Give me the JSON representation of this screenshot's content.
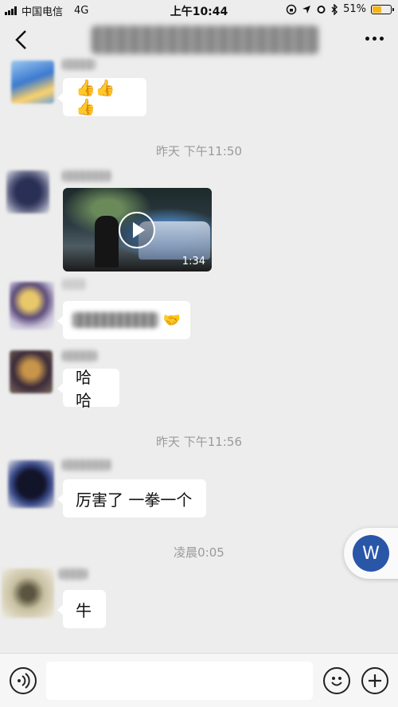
{
  "status_bar": {
    "carrier": "中国电信",
    "network": "4G",
    "time": "上午10:44",
    "battery_percent": "51%",
    "battery_level": 0.51
  },
  "messages": [
    {
      "type": "emoji",
      "content": "👍👍👍"
    },
    {
      "type": "timestamp",
      "content": "昨天 下午11:50"
    },
    {
      "type": "video",
      "duration": "1:34"
    },
    {
      "type": "text_blurred",
      "trailing_emoji": "🤝"
    },
    {
      "type": "text",
      "content": "哈哈"
    },
    {
      "type": "timestamp",
      "content": "昨天 下午11:56"
    },
    {
      "type": "text",
      "content": "厉害了 一拳一个"
    },
    {
      "type": "timestamp",
      "content": "凌晨0:05"
    },
    {
      "type": "text",
      "content": "牛"
    }
  ],
  "floating_button": {
    "label": "W",
    "color": "#2a56a8"
  },
  "input": {
    "placeholder": "",
    "value": ""
  }
}
